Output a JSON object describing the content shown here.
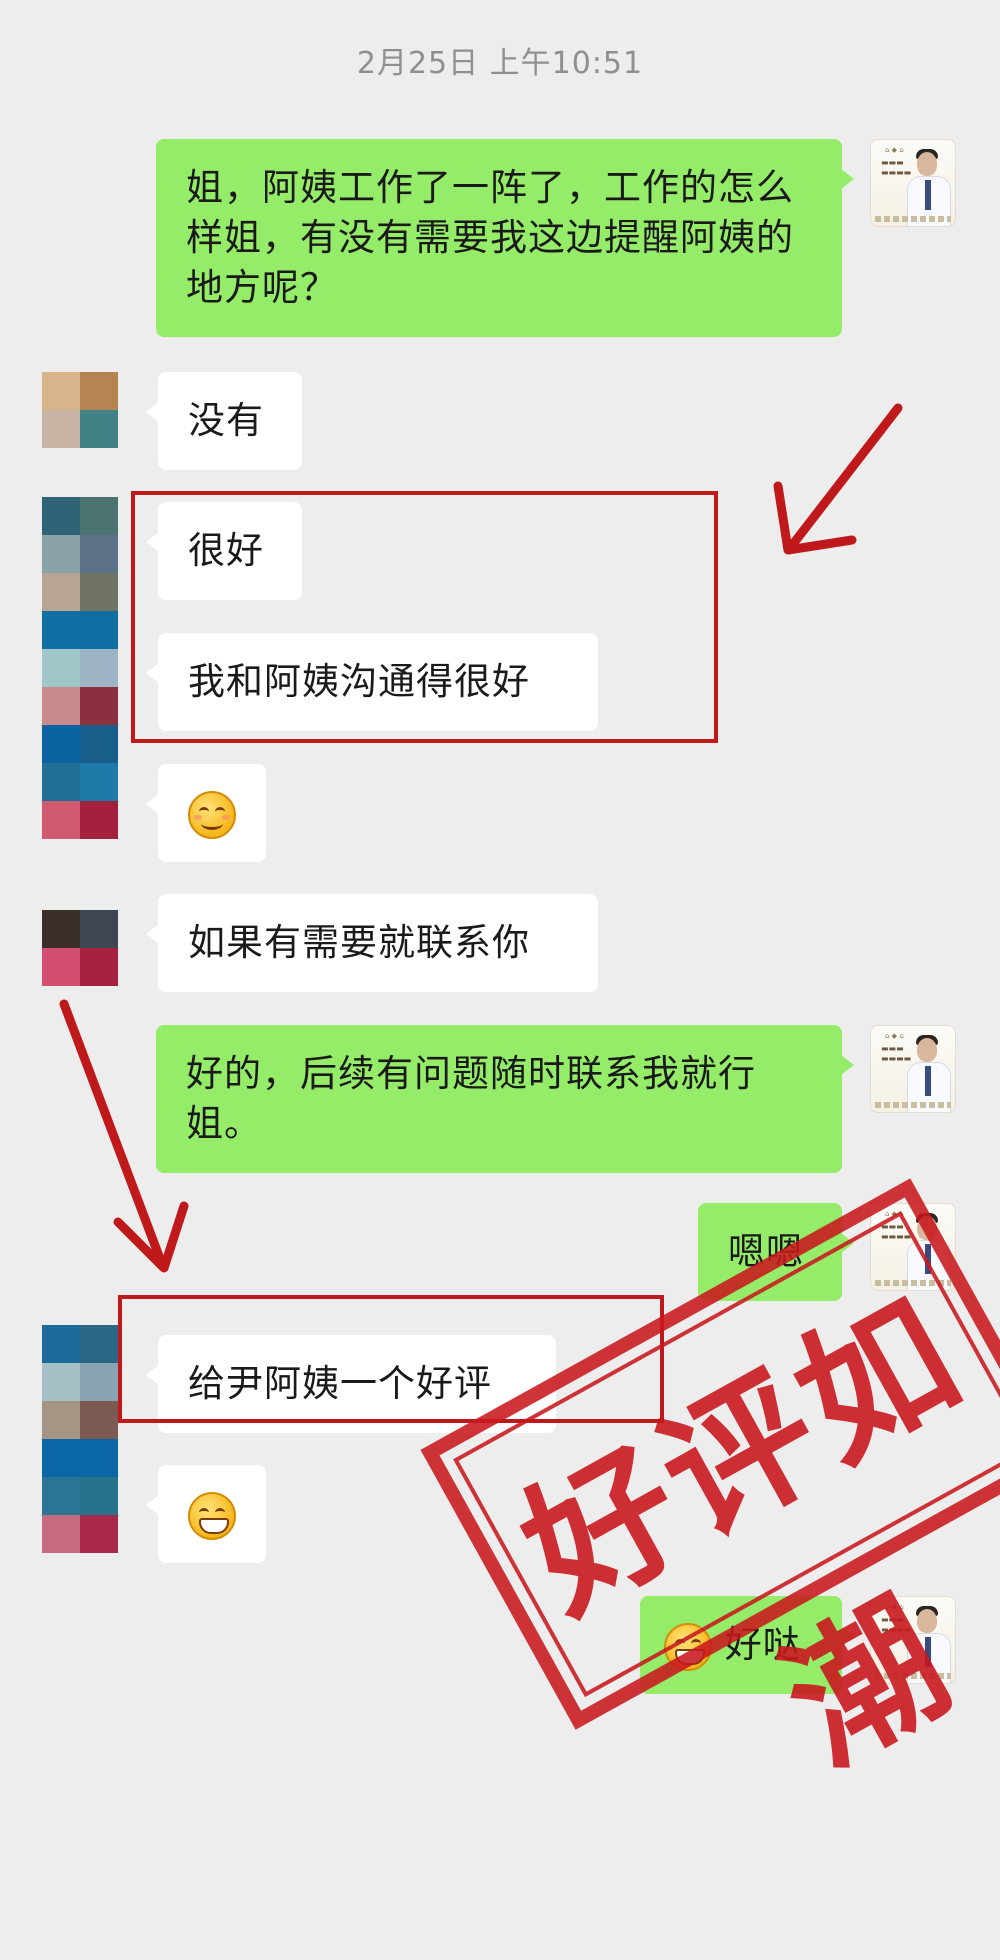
{
  "chat": {
    "timestamp": "2月25日 上午10:51",
    "messages": [
      {
        "id": "m1",
        "side": "right",
        "text": "姐，阿姨工作了一阵了，工作的怎么样姐，有没有需要我这边提醒阿姨的地方呢？"
      },
      {
        "id": "m2",
        "side": "left",
        "text": "没有"
      },
      {
        "id": "m3",
        "side": "left",
        "text": "很好"
      },
      {
        "id": "m4",
        "side": "left",
        "text": "我和阿姨沟通得很好"
      },
      {
        "id": "m5",
        "side": "left",
        "emoji": "smiling-face-emoji"
      },
      {
        "id": "m6",
        "side": "left",
        "text": "如果有需要就联系你"
      },
      {
        "id": "m7",
        "side": "right",
        "text": "好的，后续有问题随时联系我就行姐。"
      },
      {
        "id": "m8",
        "side": "right",
        "text": "嗯嗯"
      },
      {
        "id": "m9",
        "side": "left",
        "text": "给尹阿姨一个好评"
      },
      {
        "id": "m10",
        "side": "left",
        "emoji": "grinning-face-emoji"
      },
      {
        "id": "m11",
        "side": "right",
        "emoji": "grinning-face-emoji",
        "text": "好哒"
      }
    ]
  },
  "stamp": {
    "text": "好评如潮"
  },
  "colors": {
    "background": "#ededed",
    "self_bubble": "#95ec69",
    "other_bubble": "#ffffff",
    "annotation_red": "#c0191b"
  },
  "icons": {
    "agent_avatar": "agent-avatar",
    "customer_avatar": "pixelated-avatar",
    "annotation_arrows": "red-arrow-icon"
  }
}
